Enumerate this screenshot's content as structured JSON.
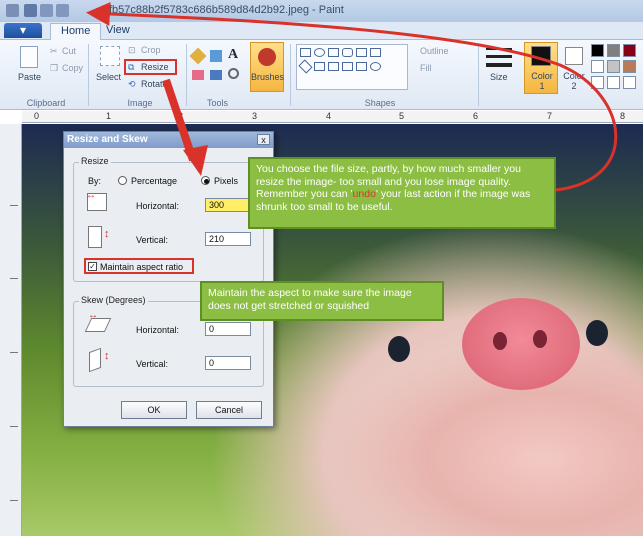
{
  "window": {
    "title": "effb57c88b2f5783c686b589d84d2b92.jpeg - Paint"
  },
  "tabs": {
    "file_label": "▾",
    "home": "Home",
    "view": "View"
  },
  "ribbon": {
    "clipboard": {
      "paste": "Paste",
      "cut": "Cut",
      "copy": "Copy",
      "group": "Clipboard"
    },
    "image": {
      "select": "Select",
      "crop": "Crop",
      "resize": "Resize",
      "rotate": "Rotate",
      "group": "Image"
    },
    "tools": {
      "text_tool": "A",
      "group": "Tools"
    },
    "brushes": "Brushes",
    "shapes": {
      "outline": "Outline",
      "fill": "Fill",
      "group": "Shapes"
    },
    "size": "Size",
    "color1": "Color 1",
    "color2": "Color 2",
    "colors": {
      "color1_value": "#111111",
      "color2_value": "#ffffff",
      "accent": "#d8322a",
      "callout_bg": "#8cbe44"
    }
  },
  "ruler": {
    "ticks": [
      "0",
      "1",
      "2",
      "3",
      "4",
      "5",
      "6",
      "7",
      "8"
    ]
  },
  "dialog": {
    "title": "Resize and Skew",
    "close": "x",
    "resize_legend": "Resize",
    "by_label": "By:",
    "percentage_label": "Percentage",
    "pixels_label": "Pixels",
    "horizontal_label": "Horizontal:",
    "horizontal_value": "300",
    "vertical_label": "Vertical:",
    "vertical_value": "210",
    "maintain_label": "Maintain aspect ratio",
    "maintain_checked": true,
    "skew_legend": "Skew (Degrees)",
    "skew_horizontal_label": "Horizontal:",
    "skew_horizontal_value": "0",
    "skew_vertical_label": "Vertical:",
    "skew_vertical_value": "0",
    "ok": "OK",
    "cancel": "Cancel"
  },
  "callouts": {
    "size_part1": "You choose the file size, partly, by how much smaller you resize the image- too small and you lose image quality. Remember you can '",
    "size_undo": "undo",
    "size_part2": "' your last action if the image was shrunk too small to be useful.",
    "aspect": "Maintain the aspect to make sure the image does not get stretched or squished"
  }
}
